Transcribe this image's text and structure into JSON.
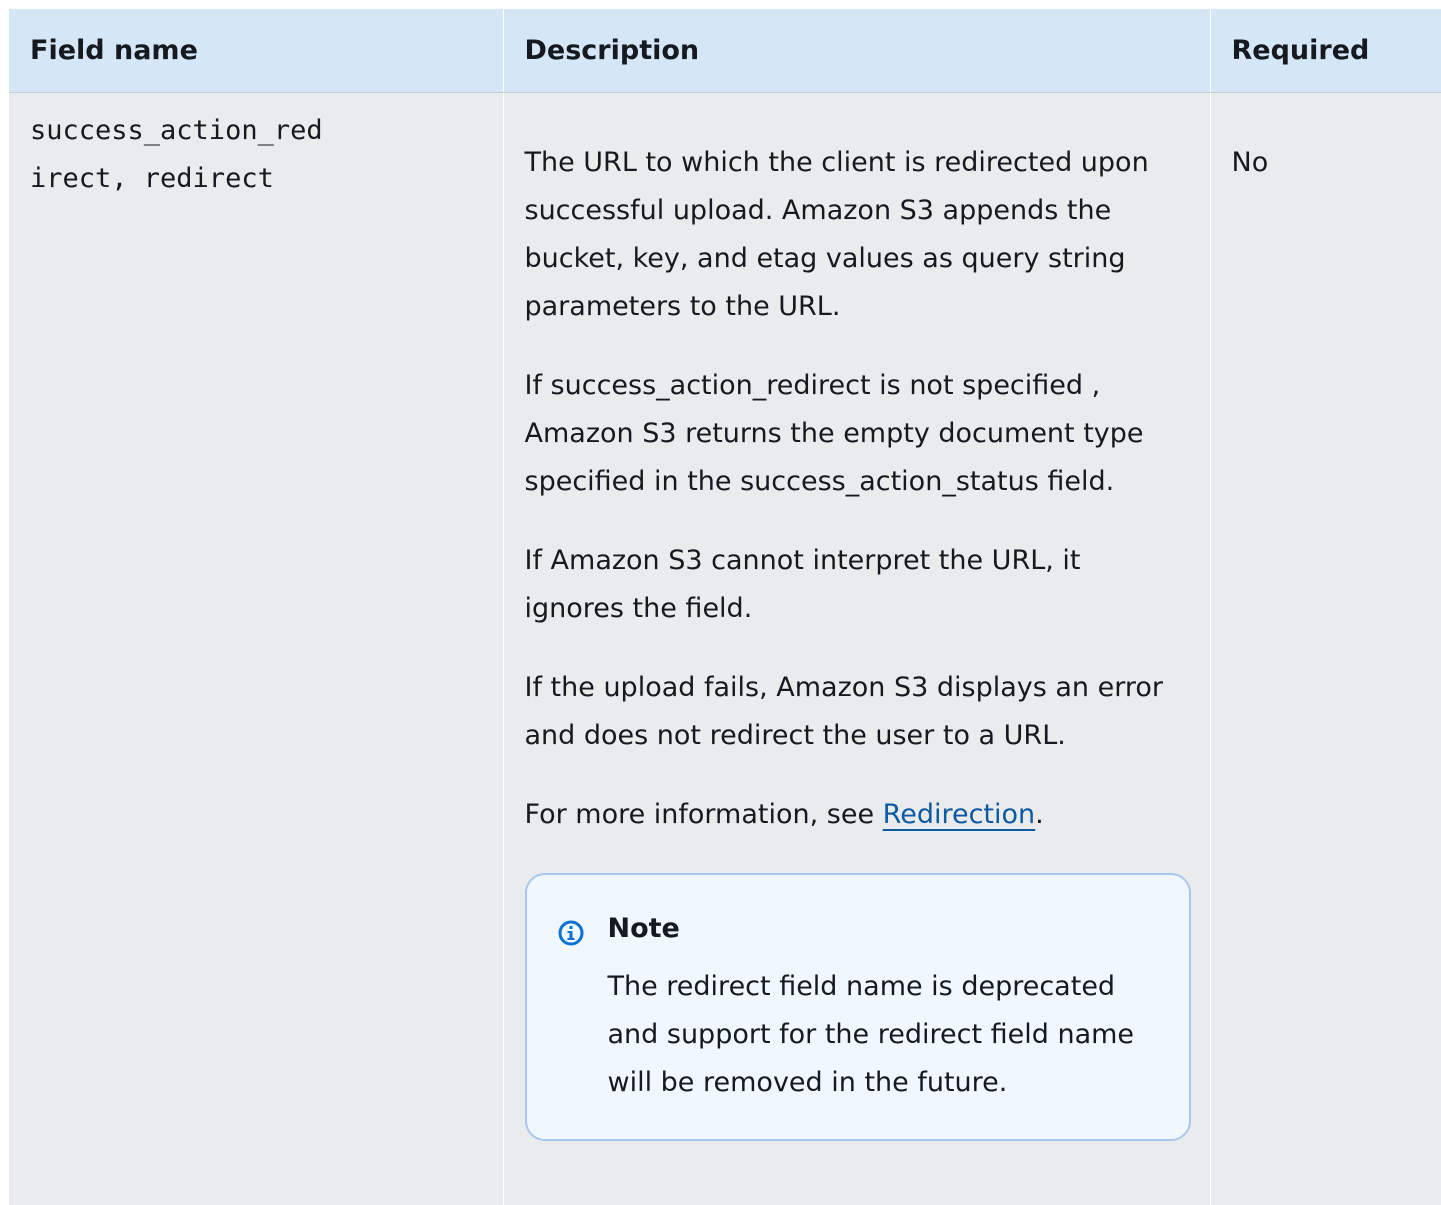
{
  "table": {
    "headers": {
      "field_name": "Field name",
      "description": "Description",
      "required": "Required"
    },
    "row": {
      "field_name": "success_action_redirect, redirect",
      "field_name_line1": "success_action_red",
      "field_name_line2": "irect, redirect",
      "required": "No",
      "description": {
        "para1": "The URL to which the client is redirected upon successful upload. Amazon S3 appends  the bucket, key, and etag values as query string parameters to  the URL.",
        "para2": "If success_action_redirect is not specified , Amazon S3  returns the empty document type specified in the  success_action_status field.",
        "para3": "If Amazon S3 cannot interpret the URL, it ignores the field.",
        "para4": "If the upload fails, Amazon S3 displays an error and does not  redirect the user to a URL.",
        "para5_prefix": "For more information, see ",
        "para5_link": "Redirection",
        "para5_suffix": "."
      },
      "note": {
        "icon": "info-icon",
        "title": "Note",
        "body": "The redirect field name is deprecated and support for  the redirect field name will be removed in the future."
      }
    }
  },
  "colors": {
    "header_bg": "#d5e6f7",
    "row_bg": "#eaebed",
    "link": "#0b5aa3",
    "note_border": "#a8c8ec",
    "note_bg": "#f1f8fd",
    "info_icon": "#0972d3"
  }
}
